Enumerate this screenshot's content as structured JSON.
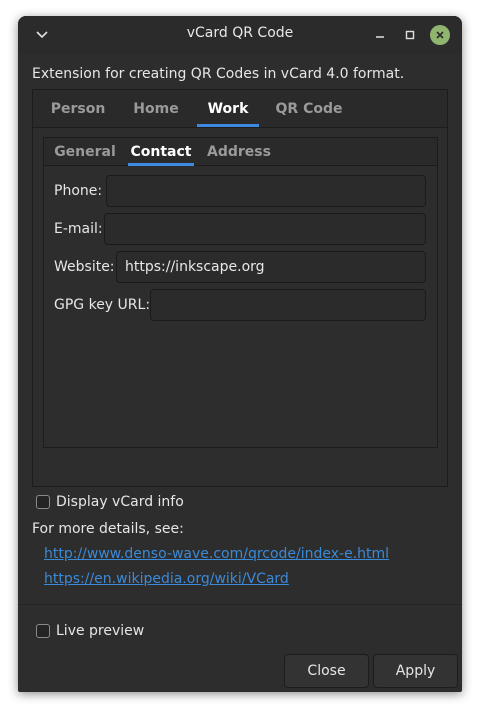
{
  "window": {
    "title": "vCard QR Code",
    "menu_icon": "chevron-down",
    "minimize_icon": "minimize",
    "maximize_icon": "maximize",
    "close_icon": "close"
  },
  "description": "Extension for creating QR Codes in vCard 4.0 format.",
  "outer_tabs": [
    {
      "label": "Person",
      "active": false
    },
    {
      "label": "Home",
      "active": false
    },
    {
      "label": "Work",
      "active": true
    },
    {
      "label": "QR Code",
      "active": false
    }
  ],
  "inner_tabs": [
    {
      "label": "General",
      "active": false
    },
    {
      "label": "Contact",
      "active": true
    },
    {
      "label": "Address",
      "active": false
    }
  ],
  "fields": [
    {
      "label": "Phone:",
      "value": ""
    },
    {
      "label": "E-mail:",
      "value": ""
    },
    {
      "label": "Website:",
      "value": "https://inkscape.org"
    },
    {
      "label": "GPG key URL:",
      "value": ""
    }
  ],
  "display_vcard_info": {
    "label": "Display vCard info",
    "checked": false
  },
  "details_text": "For more details, see:",
  "links": [
    "http://www.denso-wave.com/qrcode/index-e.html",
    "https://en.wikipedia.org/wiki/VCard"
  ],
  "live_preview": {
    "label": "Live preview",
    "checked": false
  },
  "buttons": {
    "close": "Close",
    "apply": "Apply"
  },
  "colors": {
    "background": "#2d2d2d",
    "accent": "#3d8ae0",
    "link": "#3b8ad8",
    "close_button": "#8fb56f"
  }
}
